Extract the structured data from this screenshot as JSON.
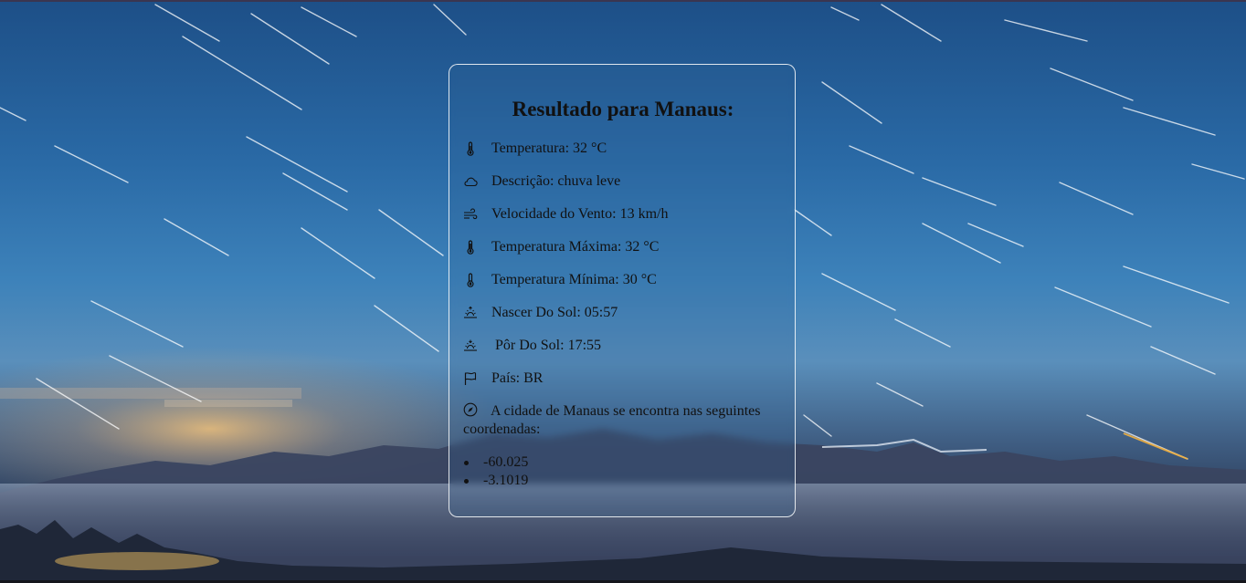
{
  "card": {
    "title": "Resultado para Manaus:",
    "rows": [
      {
        "icon": "thermometer-icon",
        "text": "Temperatura: 32 °C"
      },
      {
        "icon": "cloud-icon",
        "text": "Descrição: chuva leve"
      },
      {
        "icon": "wind-icon",
        "text": "Velocidade do Vento: 13 km/h"
      },
      {
        "icon": "thermometer-icon",
        "text": "Temperatura Máxima: 32 °C"
      },
      {
        "icon": "thermometer-icon",
        "text": "Temperatura Mínima: 30 °C"
      },
      {
        "icon": "sunrise-icon",
        "text": "Nascer Do Sol: 05:57"
      },
      {
        "icon": "sunset-icon",
        "text": "Pôr Do Sol: 17:55"
      },
      {
        "icon": "flag-icon",
        "text": "País: BR"
      }
    ],
    "coordinates_label": "A cidade de Manaus se encontra nas seguintes coordenadas:",
    "coordinates_icon": "compass-icon",
    "coordinates": [
      "-60.025",
      "-3.1019"
    ]
  },
  "colors": {
    "text": "#111111",
    "card_border": "#ffffff"
  }
}
